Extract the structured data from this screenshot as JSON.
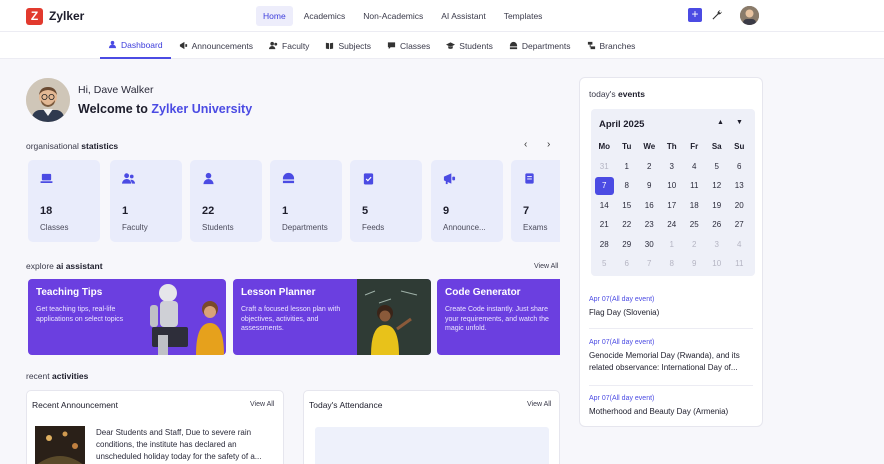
{
  "app": {
    "logo_letter": "Z",
    "name": "Zylker"
  },
  "topnav": [
    "Home",
    "Academics",
    "Non-Academics",
    "AI Assistant",
    "Templates"
  ],
  "subnav": [
    "Dashboard",
    "Announcements",
    "Faculty",
    "Subjects",
    "Classes",
    "Students",
    "Departments",
    "Branches"
  ],
  "greeting": {
    "hi": "Hi, Dave Walker",
    "welcome": "Welcome to ",
    "university": "Zylker University"
  },
  "stats_section": {
    "prefix": "organisational ",
    "bold": "statistics",
    "prev": "‹",
    "next": "›"
  },
  "stats": [
    {
      "num": "18",
      "label": "Classes",
      "icon": "laptop-icon"
    },
    {
      "num": "1",
      "label": "Faculty",
      "icon": "users-icon"
    },
    {
      "num": "22",
      "label": "Students",
      "icon": "user-icon"
    },
    {
      "num": "1",
      "label": "Departments",
      "icon": "building-icon"
    },
    {
      "num": "5",
      "label": "Feeds",
      "icon": "clipboard-icon"
    },
    {
      "num": "9",
      "label": "Announce...",
      "icon": "megaphone-icon"
    },
    {
      "num": "7",
      "label": "Exams",
      "icon": "exam-icon"
    }
  ],
  "ai_section": {
    "prefix": "explore ",
    "bold": "ai assistant",
    "view_all": "View All"
  },
  "ai_cards": [
    {
      "title": "Teaching Tips",
      "desc": "Get teaching tips, real-life applications on select topics"
    },
    {
      "title": "Lesson Planner",
      "desc": "Craft a focused lesson plan with objectives, activities, and assessments."
    },
    {
      "title": "Code Generator",
      "desc": "Create Code instantly. Just share your requirements, and watch the magic unfold."
    }
  ],
  "activities": {
    "prefix": "recent ",
    "bold": "activities"
  },
  "recent_announcement": {
    "title": "Recent Announcement",
    "view_all": "View All",
    "text": "Dear Students and Staff, Due to severe rain conditions, the institute has declared an unscheduled holiday today for the safety of a..."
  },
  "attendance": {
    "title": "Today's Attendance",
    "view_all": "View All"
  },
  "events": {
    "prefix": "today's ",
    "bold": "events",
    "month": "April 2025",
    "up": "▲",
    "down": "▼",
    "weekdays": [
      "Mo",
      "Tu",
      "We",
      "Th",
      "Fr",
      "Sa",
      "Su"
    ],
    "days": [
      [
        "31",
        "mut"
      ],
      [
        "1",
        ""
      ],
      [
        "2",
        ""
      ],
      [
        "3",
        ""
      ],
      [
        "4",
        ""
      ],
      [
        "5",
        ""
      ],
      [
        "6",
        ""
      ],
      [
        "7",
        "sel"
      ],
      [
        "8",
        ""
      ],
      [
        "9",
        ""
      ],
      [
        "10",
        ""
      ],
      [
        "11",
        ""
      ],
      [
        "12",
        ""
      ],
      [
        "13",
        ""
      ],
      [
        "14",
        ""
      ],
      [
        "15",
        ""
      ],
      [
        "16",
        ""
      ],
      [
        "17",
        ""
      ],
      [
        "18",
        ""
      ],
      [
        "19",
        ""
      ],
      [
        "20",
        ""
      ],
      [
        "21",
        ""
      ],
      [
        "22",
        ""
      ],
      [
        "23",
        ""
      ],
      [
        "24",
        ""
      ],
      [
        "25",
        ""
      ],
      [
        "26",
        ""
      ],
      [
        "27",
        ""
      ],
      [
        "28",
        ""
      ],
      [
        "29",
        ""
      ],
      [
        "30",
        ""
      ],
      [
        "1",
        "mut"
      ],
      [
        "2",
        "mut"
      ],
      [
        "3",
        "mut"
      ],
      [
        "4",
        "mut"
      ],
      [
        "5",
        "mut"
      ],
      [
        "6",
        "mut"
      ],
      [
        "7",
        "mut"
      ],
      [
        "8",
        "mut"
      ],
      [
        "9",
        "mut"
      ],
      [
        "10",
        "mut"
      ],
      [
        "11",
        "mut"
      ]
    ],
    "list": [
      {
        "date": "Apr 07(All day event)",
        "name": "Flag Day (Slovenia)"
      },
      {
        "date": "Apr 07(All day event)",
        "name": "Genocide Memorial Day (Rwanda), and its related observance: International Day of..."
      },
      {
        "date": "Apr 07(All day event)",
        "name": "Motherhood and Beauty Day (Armenia)"
      }
    ]
  }
}
